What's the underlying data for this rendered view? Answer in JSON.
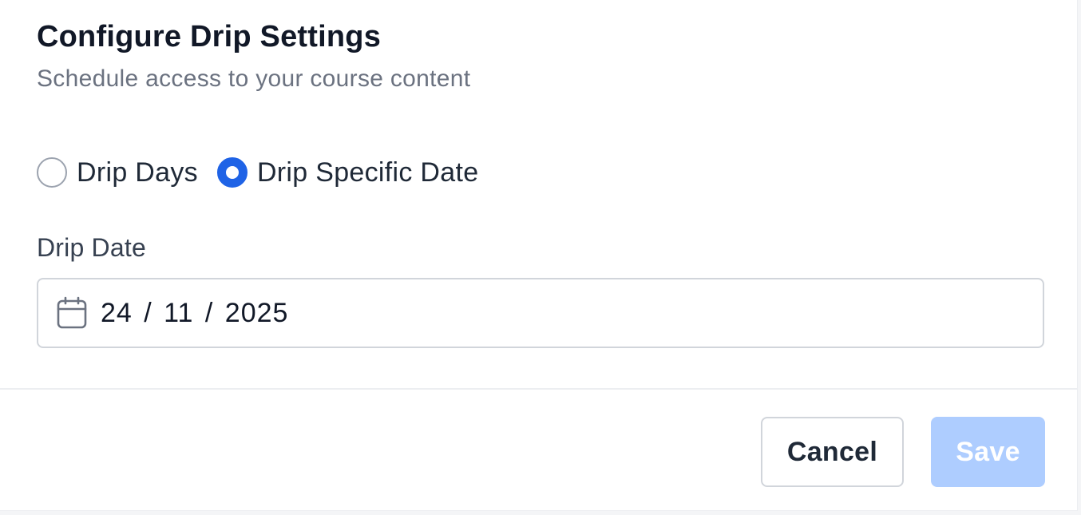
{
  "dialog": {
    "title": "Configure Drip Settings",
    "subtitle": "Schedule access to your course content"
  },
  "drip_type": {
    "options": [
      {
        "label": "Drip Days",
        "selected": false
      },
      {
        "label": "Drip Specific Date",
        "selected": true
      }
    ]
  },
  "drip_date": {
    "label": "Drip Date",
    "value": "24 / 11 / 2025",
    "icon": "calendar-icon"
  },
  "footer": {
    "cancel_label": "Cancel",
    "save_label": "Save",
    "save_enabled": false
  },
  "colors": {
    "accent": "#1f63e6",
    "save_disabled_bg": "#aecdff",
    "title_text": "#111827",
    "subtitle_text": "#6b7280"
  }
}
